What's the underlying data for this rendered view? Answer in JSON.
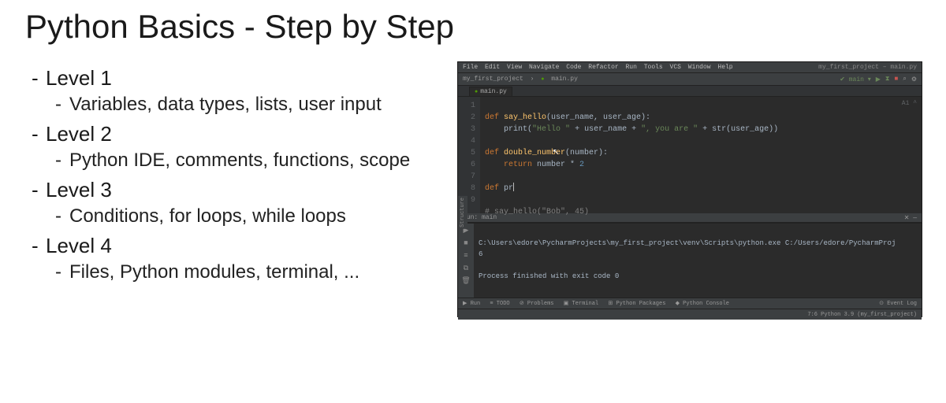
{
  "title": "Python Basics - Step by Step",
  "levels": [
    {
      "name": "Level 1",
      "desc": "Variables, data types, lists, user input"
    },
    {
      "name": "Level 2",
      "desc": "Python IDE, comments, functions, scope"
    },
    {
      "name": "Level 3",
      "desc": "Conditions, for loops, while loops"
    },
    {
      "name": "Level 4",
      "desc": "Files, Python modules, terminal, ..."
    }
  ],
  "ide": {
    "menus": [
      "File",
      "Edit",
      "View",
      "Navigate",
      "Code",
      "Refactor",
      "Run",
      "Tools",
      "VCS",
      "Window",
      "Help"
    ],
    "window_title": "my_first_project – main.py",
    "breadcrumb": {
      "project": "my_first_project",
      "file": "main.py"
    },
    "run_config": "main",
    "tab": "main.py",
    "hint": "A1 ^",
    "side_label": "Structure",
    "line_numbers": [
      "1",
      "2",
      "3",
      "4",
      "5",
      "6",
      "7",
      "8",
      "9"
    ],
    "code": {
      "l1": {
        "def": "def ",
        "fn": "say_hello",
        "sig": "(user_name, user_age):"
      },
      "l2": {
        "indent": "    ",
        "call": "print",
        "open": "(",
        "s1": "\"Hello \"",
        "p1": " + user_name + ",
        "s2": "\", you are \"",
        "p2": " + ",
        "strf": "str",
        "rest": "(user_age))"
      },
      "l3": "",
      "l4": {
        "def": "def ",
        "fn": "double_number",
        "sig": "(number):"
      },
      "l5": {
        "indent": "    ",
        "ret": "return ",
        "expr1": "number * ",
        "n": "2"
      },
      "l6": "",
      "l7": {
        "def": "def ",
        "partial": "pr"
      },
      "l8": "",
      "l9": {
        "cmt": "# say_hello(\"Bob\", 45)"
      }
    },
    "run": {
      "header_left": "Run:   main",
      "header_right": "✕  —",
      "cmd": "C:\\Users\\edore\\PycharmProjects\\my_first_project\\venv\\Scripts\\python.exe C:/Users/edore/PycharmProj",
      "out1": "6",
      "out2": "",
      "out3": "Process finished with exit code 0"
    },
    "bottom": {
      "items": [
        "▶ Run",
        "≡ TODO",
        "⊘ Problems",
        "▣ Terminal",
        "⊞ Python Packages",
        "◆ Python Console"
      ],
      "event_log": "⊙ Event Log"
    },
    "status": "7:6  Python 3.9 (my_first_project)"
  }
}
